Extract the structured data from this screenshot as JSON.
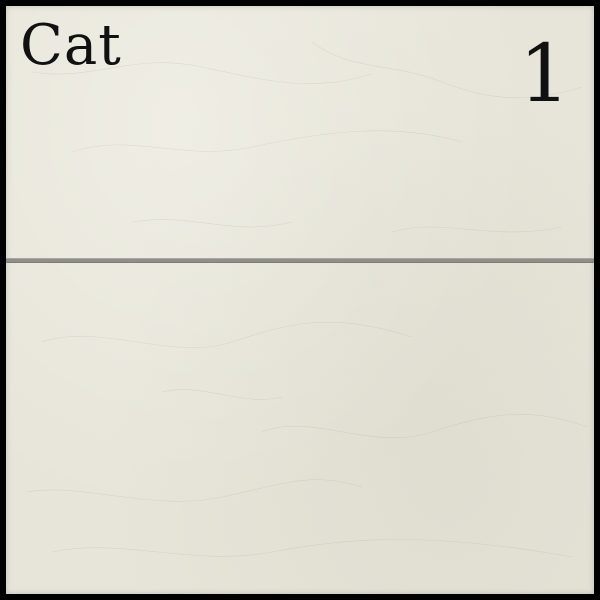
{
  "card": {
    "title": "Cat",
    "number": "1"
  },
  "colors": {
    "background": "#000000",
    "paper": "#e7e5d9",
    "ink": "#111111",
    "fold_line": "#8f8e88"
  }
}
